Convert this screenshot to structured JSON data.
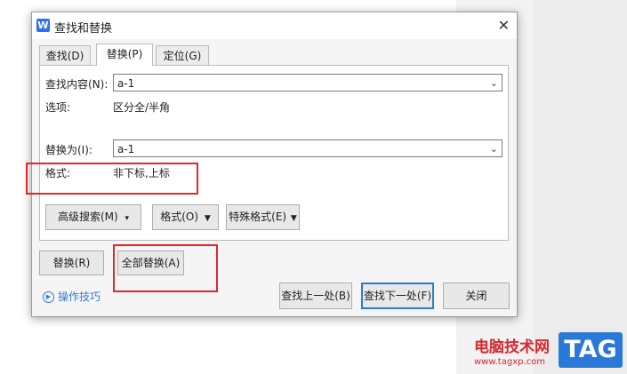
{
  "window": {
    "title": "查找和替换",
    "logo_letter": "W",
    "close_glyph": "✕"
  },
  "tabs": [
    {
      "label": "查找(D)"
    },
    {
      "label": "替换(P)"
    },
    {
      "label": "定位(G)"
    }
  ],
  "find": {
    "label": "查找内容(N):",
    "value": "a-1",
    "options_label": "选项:",
    "options_value": "区分全/半角"
  },
  "replace": {
    "label": "替换为(I):",
    "value": "a-1",
    "format_label": "格式:",
    "format_value": "非下标,上标"
  },
  "format_buttons": {
    "advanced": "高级搜索(M)",
    "format": "格式(O)",
    "special": "特殊格式(E)"
  },
  "action_buttons": {
    "replace": "替换(R)",
    "replace_all": "全部替换(A)",
    "find_prev": "查找上一处(B)",
    "find_next": "查找下一处(F)",
    "close": "关闭"
  },
  "tips": "操作技巧",
  "watermark": {
    "site_name": "电脑技术网",
    "url": "www.tagxp.com",
    "tag": "TAG"
  },
  "colors": {
    "accent_blue": "#2d7ad6",
    "highlight_red": "#e3262b"
  }
}
